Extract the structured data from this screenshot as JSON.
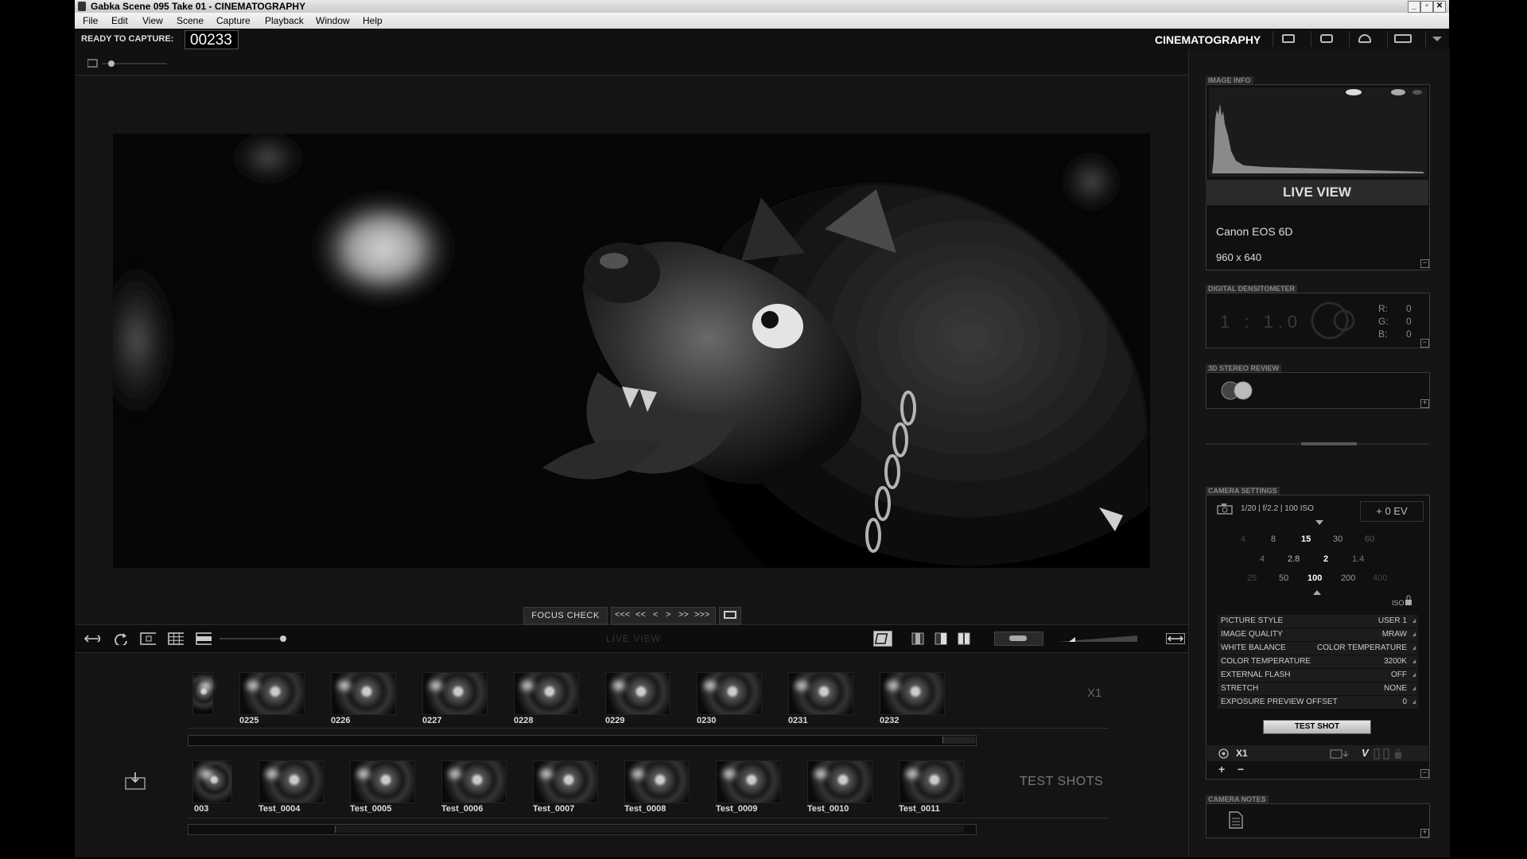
{
  "window": {
    "title": "Gabka  Scene 095  Take 01 - CINEMATOGRAPHY",
    "controls": [
      "_",
      "▫",
      "✕"
    ]
  },
  "menu": [
    "File",
    "Edit",
    "View",
    "Scene",
    "Capture",
    "Playback",
    "Window",
    "Help"
  ],
  "status": {
    "ready_label": "READY TO CAPTURE:",
    "frame_counter": "00233",
    "workspace": "CINEMATOGRAPHY"
  },
  "transport": {
    "focus_check": "FOCUS CHECK",
    "nav": [
      "<<<",
      "<<",
      "<",
      ">",
      ">>",
      ">>>"
    ],
    "view_label": "LIVE VIEW"
  },
  "timeline": {
    "frames": [
      "0225",
      "0226",
      "0227",
      "0228",
      "0229",
      "0230",
      "0231",
      "0232"
    ],
    "scale": "X1"
  },
  "test_shots": {
    "partial_label": "003",
    "frames": [
      "Test_0004",
      "Test_0005",
      "Test_0006",
      "Test_0007",
      "Test_0008",
      "Test_0009",
      "Test_0010",
      "Test_0011"
    ],
    "label": "TEST SHOTS"
  },
  "image_info": {
    "header": "IMAGE INFO",
    "mode": "LIVE VIEW",
    "camera": "Canon EOS 6D",
    "resolution": "960 x 640"
  },
  "densitometer": {
    "header": "DIGITAL DENSITOMETER",
    "ratio": "1 : 1.0",
    "r_label": "R:",
    "r": "0",
    "g_label": "G:",
    "g": "0",
    "b_label": "B:",
    "b": "0"
  },
  "stereo": {
    "header": "3D STEREO REVIEW"
  },
  "camera_settings": {
    "header": "CAMERA SETTINGS",
    "exposure": "1/20 | f/2.2 | 100 ISO",
    "ev": "+ 0 EV",
    "shutter_scale": [
      "4",
      "8",
      "15",
      "30",
      "60"
    ],
    "aperture_scale": [
      "4",
      "2.8",
      "2",
      "1.4"
    ],
    "iso_scale": [
      "25",
      "50",
      "100",
      "200",
      "400"
    ],
    "iso_label": "ISO",
    "rows": [
      {
        "key": "PICTURE STYLE",
        "value": "USER 1"
      },
      {
        "key": "IMAGE QUALITY",
        "value": "MRAW"
      },
      {
        "key": "WHITE BALANCE",
        "value": "COLOR TEMPERATURE"
      },
      {
        "key": "COLOR TEMPERATURE",
        "value": "3200K"
      },
      {
        "key": "EXTERNAL FLASH",
        "value": "OFF"
      },
      {
        "key": "STRETCH",
        "value": "NONE"
      },
      {
        "key": "EXPOSURE PREVIEW OFFSET",
        "value": "0"
      }
    ],
    "test_shot": "TEST SHOT",
    "x1": "X1",
    "v": "V"
  },
  "camera_notes": {
    "header": "CAMERA NOTES"
  }
}
